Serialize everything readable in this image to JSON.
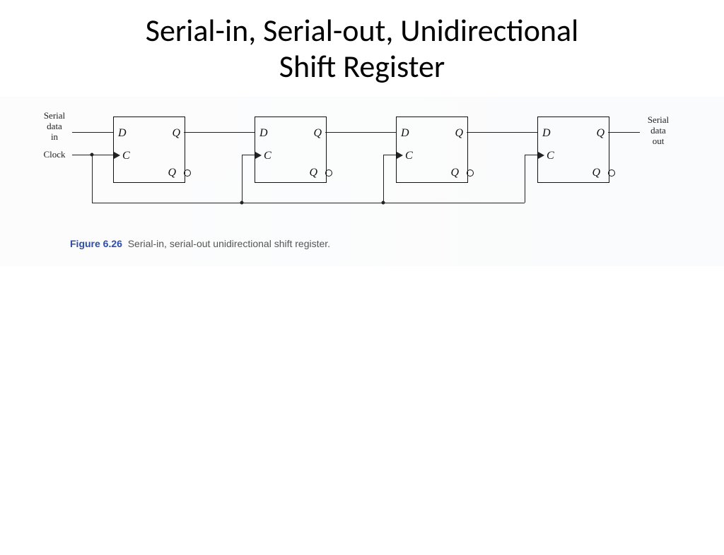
{
  "title_line1": "Serial-in, Serial-out, Unidirectional",
  "title_line2": "Shift Register",
  "labels": {
    "serial_in_1": "Serial",
    "serial_in_2": "data",
    "serial_in_3": "in",
    "clock": "Clock",
    "serial_out_1": "Serial",
    "serial_out_2": "data",
    "serial_out_3": "out",
    "D": "D",
    "Q": "Q",
    "C": "C",
    "Qbar": "Q"
  },
  "caption_fig": "Figure 6.26",
  "caption_text": "Serial-in, serial-out unidirectional shift register."
}
